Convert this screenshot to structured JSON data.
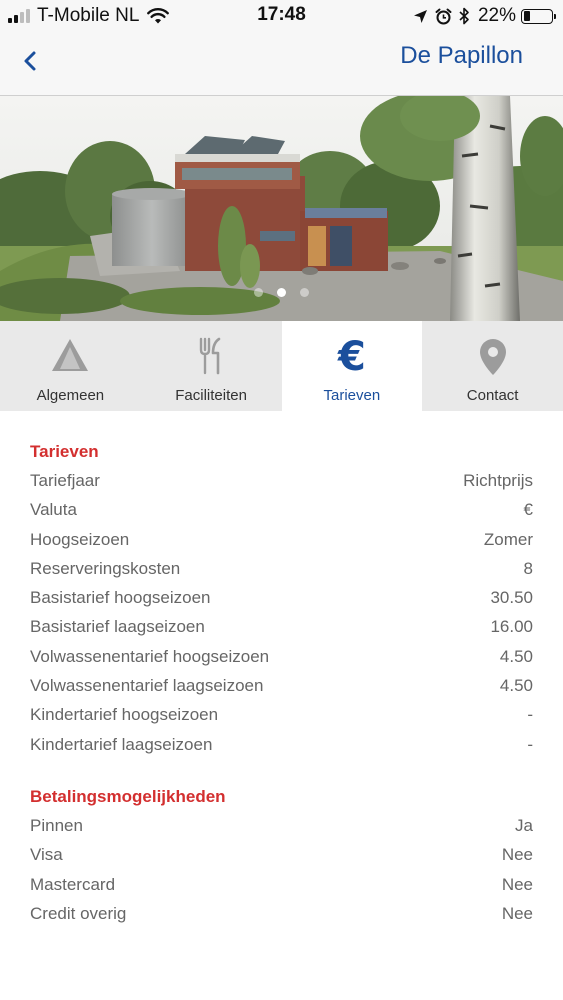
{
  "status_bar": {
    "carrier": "T-Mobile NL",
    "time": "17:48",
    "battery_percent": "22%",
    "battery_level": 0.22,
    "icons": [
      "signal-icon",
      "wifi-icon",
      "location-arrow-icon",
      "alarm-icon",
      "bluetooth-icon",
      "battery-icon"
    ]
  },
  "nav": {
    "back_icon": "chevron-left-icon",
    "title": "De Papillon"
  },
  "hero": {
    "slide_count": 3,
    "active_slide": 2
  },
  "tabs": [
    {
      "label": "Algemeen",
      "icon": "tent-icon",
      "active": false
    },
    {
      "label": "Faciliteiten",
      "icon": "fork-knife-icon",
      "active": false
    },
    {
      "label": "Tarieven",
      "icon": "euro-icon",
      "glyph": "€",
      "active": true
    },
    {
      "label": "Contact",
      "icon": "map-pin-icon",
      "active": false
    }
  ],
  "sections": [
    {
      "title": "Tarieven",
      "rows": [
        {
          "label": "Tariefjaar",
          "value": "Richtprijs"
        },
        {
          "label": "Valuta",
          "value": "€"
        },
        {
          "label": "Hoogseizoen",
          "value": "Zomer"
        },
        {
          "label": "Reserveringskosten",
          "value": "8"
        },
        {
          "label": "Basistarief hoogseizoen",
          "value": "30.50"
        },
        {
          "label": "Basistarief laagseizoen",
          "value": "16.00"
        },
        {
          "label": "Volwassenentarief hoogseizoen",
          "value": "4.50"
        },
        {
          "label": "Volwassenentarief laagseizoen",
          "value": "4.50"
        },
        {
          "label": "Kindertarief hoogseizoen",
          "value": "-"
        },
        {
          "label": "Kindertarief laagseizoen",
          "value": "-"
        }
      ]
    },
    {
      "title": "Betalingsmogelijkheden",
      "rows": [
        {
          "label": "Pinnen",
          "value": "Ja"
        },
        {
          "label": "Visa",
          "value": "Nee"
        },
        {
          "label": "Mastercard",
          "value": "Nee"
        },
        {
          "label": "Credit overig",
          "value": "Nee"
        }
      ]
    }
  ],
  "colors": {
    "accent_blue": "#1b4f9c",
    "section_red": "#d32f2f",
    "tab_inactive_bg": "#e9e9e9",
    "row_text": "#666666"
  }
}
